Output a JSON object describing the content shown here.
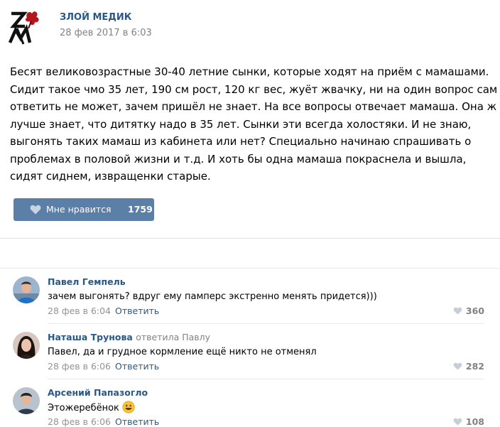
{
  "post": {
    "author": "ЗЛОЙ МЕДИК",
    "date": "28 фев 2017 в 6:03",
    "logo_icon": "zm-logo-icon",
    "text_lines": [
      "Бесят великовозрастные 30-40 летние сынки, которые ходят на приём с мамашами.",
      "Сидит такое чмо 35 лет, 190 см рост, 120 кг вес, жуёт жвачку, ни на один вопрос сам",
      "ответить не может, зачем пришёл не знает. На все вопросы отвечает мамаша. Она ж",
      "лучше знает, что дитятку надо в 35 лет. Сынки эти всегда холостяки. И не знаю,",
      "выгонять таких мамаш из кабинета или нет? Специально начинаю спрашивать о",
      "проблемах в половой жизни и т.д. И хоть бы одна мамаша покраснела и вышла,",
      "сидят сиднем, извращенки старые."
    ],
    "like_label": "Мне нравится",
    "like_count": "1759"
  },
  "comments": [
    {
      "author": "Павел Гемпель",
      "reply_to": "",
      "text": "зачем выгонять? вдруг ему памперс экстренно менять придется)))",
      "date": "28 фев в 6:04",
      "reply_label": "Ответить",
      "likes": "360"
    },
    {
      "author": "Наташа Трунова",
      "reply_to": "ответила Павлу",
      "text": "Павел, да и грудное кормление ещё никто не отменял",
      "date": "28 фев в 6:06",
      "reply_label": "Ответить",
      "likes": "282"
    },
    {
      "author": "Арсений Папазогло",
      "reply_to": "",
      "text": "Этожеребёнок",
      "date": "28 фев в 6:06",
      "reply_label": "Ответить",
      "likes": "108"
    }
  ],
  "colors": {
    "link": "#2a5885",
    "like_button": "#5b7fa6",
    "muted": "#828282"
  }
}
